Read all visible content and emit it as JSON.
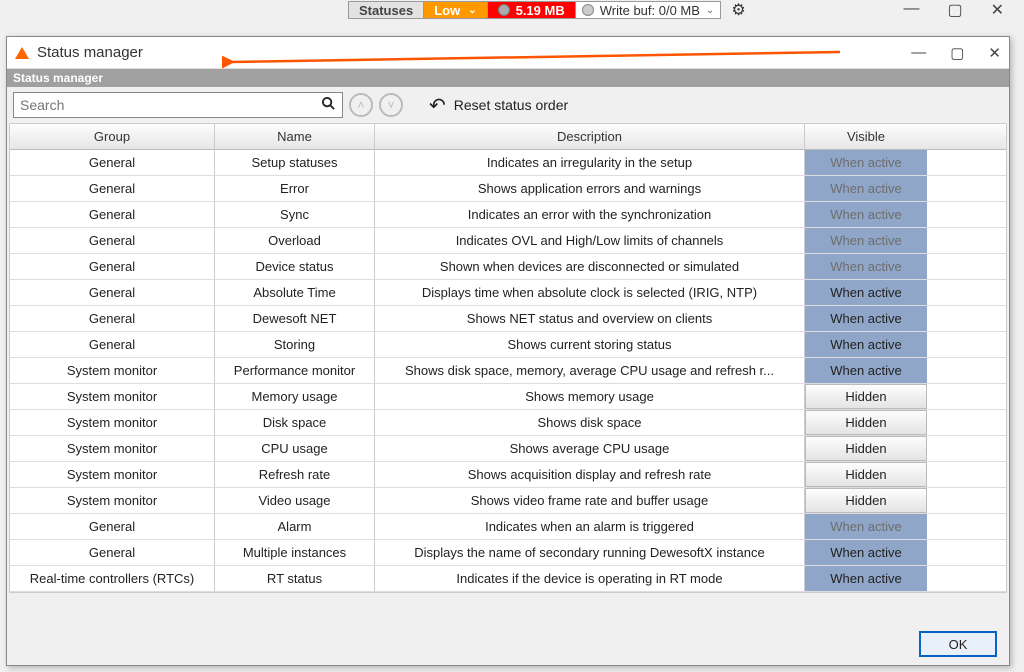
{
  "toolbar": {
    "statuses_label": "Statuses",
    "level": "Low",
    "size": "5.19 MB",
    "writebuf": "Write buf: 0/0 MB"
  },
  "dialog": {
    "title": "Status manager",
    "subtitle": "Status manager",
    "search_placeholder": "Search",
    "reset_label": "Reset status order",
    "ok_label": "OK"
  },
  "columns": {
    "group": "Group",
    "name": "Name",
    "description": "Description",
    "visible": "Visible"
  },
  "rows": [
    {
      "group": "General",
      "name": "Setup statuses",
      "desc": "Indicates an irregularity in the setup",
      "visible": "When active",
      "vstyle": "blue-dim"
    },
    {
      "group": "General",
      "name": "Error",
      "desc": "Shows application errors and warnings",
      "visible": "When active",
      "vstyle": "blue-dim"
    },
    {
      "group": "General",
      "name": "Sync",
      "desc": "Indicates an error with the synchronization",
      "visible": "When active",
      "vstyle": "blue-dim"
    },
    {
      "group": "General",
      "name": "Overload",
      "desc": "Indicates OVL and High/Low limits of channels",
      "visible": "When active",
      "vstyle": "blue-dim"
    },
    {
      "group": "General",
      "name": "Device status",
      "desc": "Shown when devices are disconnected or simulated",
      "visible": "When active",
      "vstyle": "blue-dim"
    },
    {
      "group": "General",
      "name": "Absolute Time",
      "desc": "Displays time when absolute clock is selected (IRIG, NTP)",
      "visible": "When active",
      "vstyle": "blue"
    },
    {
      "group": "General",
      "name": "Dewesoft NET",
      "desc": "Shows NET status and overview on clients",
      "visible": "When active",
      "vstyle": "blue"
    },
    {
      "group": "General",
      "name": "Storing",
      "desc": "Shows current storing status",
      "visible": "When active",
      "vstyle": "blue"
    },
    {
      "group": "System monitor",
      "name": "Performance monitor",
      "desc": "Shows disk space, memory, average CPU usage and refresh r...",
      "visible": "When active",
      "vstyle": "blue"
    },
    {
      "group": "System monitor",
      "name": "Memory usage",
      "desc": "Shows memory usage",
      "visible": "Hidden",
      "vstyle": "grey"
    },
    {
      "group": "System monitor",
      "name": "Disk space",
      "desc": "Shows disk space",
      "visible": "Hidden",
      "vstyle": "grey"
    },
    {
      "group": "System monitor",
      "name": "CPU usage",
      "desc": "Shows average CPU usage",
      "visible": "Hidden",
      "vstyle": "grey"
    },
    {
      "group": "System monitor",
      "name": "Refresh rate",
      "desc": "Shows acquisition display and refresh rate",
      "visible": "Hidden",
      "vstyle": "grey"
    },
    {
      "group": "System monitor",
      "name": "Video usage",
      "desc": "Shows video frame rate and buffer usage",
      "visible": "Hidden",
      "vstyle": "grey"
    },
    {
      "group": "General",
      "name": "Alarm",
      "desc": "Indicates when an alarm is triggered",
      "visible": "When active",
      "vstyle": "blue-dim"
    },
    {
      "group": "General",
      "name": "Multiple instances",
      "desc": "Displays the name of secondary running DewesoftX instance",
      "visible": "When active",
      "vstyle": "blue"
    },
    {
      "group": "Real-time controllers (RTCs)",
      "name": "RT status",
      "desc": "Indicates if the device is operating in RT mode",
      "visible": "When active",
      "vstyle": "blue"
    }
  ]
}
